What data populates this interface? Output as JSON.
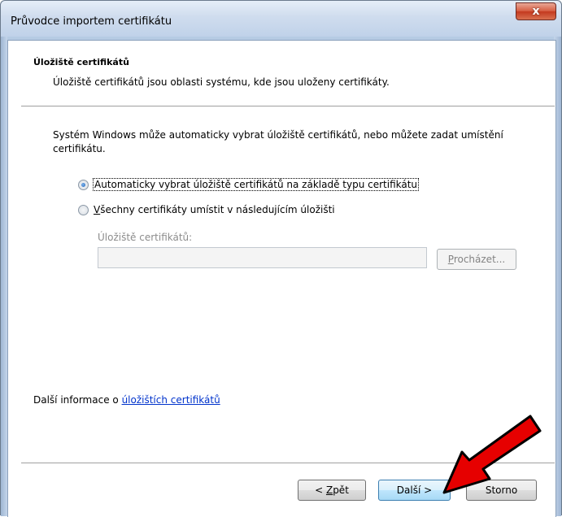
{
  "window": {
    "title": "Průvodce importem certifikátu",
    "close_glyph": "x"
  },
  "header": {
    "title": "Úložiště certifikátů",
    "subtitle": "Úložiště certifikátů jsou oblasti systému, kde jsou uloženy certifikáty."
  },
  "body": {
    "intro": "Systém Windows může automaticky vybrat úložiště certifikátů, nebo můžete zadat umístění certifikátu.",
    "radio_auto": {
      "label": "Automaticky vybrat úložiště certifikátů na základě typu certifikátu",
      "checked": true
    },
    "radio_manual": {
      "label_accel": "V",
      "label_rest": "šechny certifikáty umístit v následujícím úložišti",
      "checked": false
    },
    "store_label": "Úložiště certifikátů:",
    "store_value": "",
    "browse_accel": "P",
    "browse_rest": "rocházet..."
  },
  "more_info": {
    "prefix": "Další informace o ",
    "link": "úložištích certifikátů"
  },
  "footer": {
    "back_accel": "< ",
    "back_ul": "Z",
    "back_rest": "pět",
    "next_label": "Další >",
    "cancel_label": "Storno"
  },
  "annotation": {
    "arrow_color": "#e60000"
  }
}
